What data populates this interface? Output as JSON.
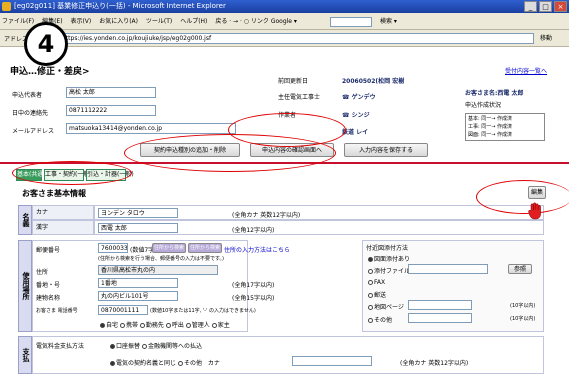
{
  "window": {
    "title": "[eg02g011] 基業修正申込り(一括) - Microsoft Internet Explorer",
    "minimize": "_",
    "maximize": "□",
    "close": "×"
  },
  "menu": {
    "items": [
      "ファイル(F)",
      "編集(E)",
      "表示(V)",
      "お気に入り(A)",
      "ツール(T)",
      "ヘルプ(H)"
    ],
    "toolbar_text": "戻る · → · ○ リンク  Google ▾",
    "search_label": "検索 ▾"
  },
  "address": {
    "label": "アドレス(D)",
    "url": "https://ies.yonden.co.jp/koujiuke/jsp/eg02g000.jsf",
    "go_label": "移動"
  },
  "step": {
    "number": "4"
  },
  "page": {
    "title": "申込…修正・差戻>",
    "top_link": "受付内容一覧へ"
  },
  "applicant": {
    "name_label": "申込代表者",
    "name_value": "高松 太郎",
    "phone_label": "日中の連絡先",
    "phone_value": "0871112222",
    "email_label": "メールアドレス",
    "email_value": "matsuoka13414@yonden.co.jp"
  },
  "meta": {
    "updated_label": "前回更新日",
    "updated_value": "20060502(松岡 宏樹",
    "engineer_label": "主任電気工事士",
    "engineer_value": "☎ ゲンデウ",
    "worker_label": "作業者",
    "worker_value": "☎ シンジ",
    "last_label": "",
    "last_value": "鉄道 レイ",
    "customer_label": "お客さま名:西電 太郎",
    "status_label": "申込作成状況"
  },
  "status_box": {
    "lines": [
      "基本: 同一→ 作成済",
      "工事: 同一→ 作成済",
      "図面: 同一→ 作成済"
    ]
  },
  "buttons": {
    "add_delete": "契約申込種別の追加・削除",
    "confirm_screen": "申込内容の確認画面へ",
    "save": "入力内容を保存する",
    "edit": "編集",
    "ref": "参照"
  },
  "tabs": [
    "基本(共通)",
    "工事・契約(一般)",
    "引込・計器(一般)"
  ],
  "section": {
    "title": "お客さま基本情報"
  },
  "name_block": {
    "header": "名義",
    "kana_label": "カナ",
    "kana_value": "ヨンデン タロウ",
    "kana_note": "(全角カナ 英数12字以内)",
    "kanji_label": "漢字",
    "kanji_value": "西電 太郎",
    "kanji_note": "(全角12字以内)"
  },
  "usage_block": {
    "header": "使用場所",
    "zip_label": "郵便番号",
    "zip_value": "7600033",
    "zip_note": "(数値7字)",
    "zip_btn1": "住所から検索",
    "zip_btn2": "住所から検索",
    "zip_help": "住所の入力方法はこちら",
    "zip_sub": "(住所から検索を行う場合、郵便番号の入力は不要です。)",
    "addr_label": "住所",
    "addr_value": "香川県高松市丸の内",
    "banchi_label": "番地・号",
    "banchi_value": "1番地",
    "banchi_note": "(全角17字以内)",
    "bldg_label": "建物名称",
    "bldg_value": "丸の内ビル101号",
    "bldg_note": "(全角15字以内)",
    "tel_label": "お客さま 電話番号",
    "tel_value": "0870001111",
    "tel_note": "(数値10字または11字, '-' の入力はできません)",
    "tel_options": [
      "自宅",
      "携帯",
      "勤務先",
      "呼出",
      "管理人",
      "家主"
    ]
  },
  "send_method": {
    "title": "付近図添付方法",
    "options": [
      "図面添付あり",
      "添付ファイル",
      "FAX",
      "郵送",
      "地図ページ",
      "その他"
    ],
    "note1": "(10字以内)",
    "note2": "(10字以内)"
  },
  "payment_block": {
    "header": "支払",
    "method_label": "電気料金支払方法",
    "method_options": [
      "口座振替",
      "金融機関等への払込"
    ],
    "contract_options": [
      "電気の契約名義と同じ",
      "その他"
    ],
    "kana_label": "カナ",
    "kana_note": "(全角カナ 英数12字以内)"
  }
}
